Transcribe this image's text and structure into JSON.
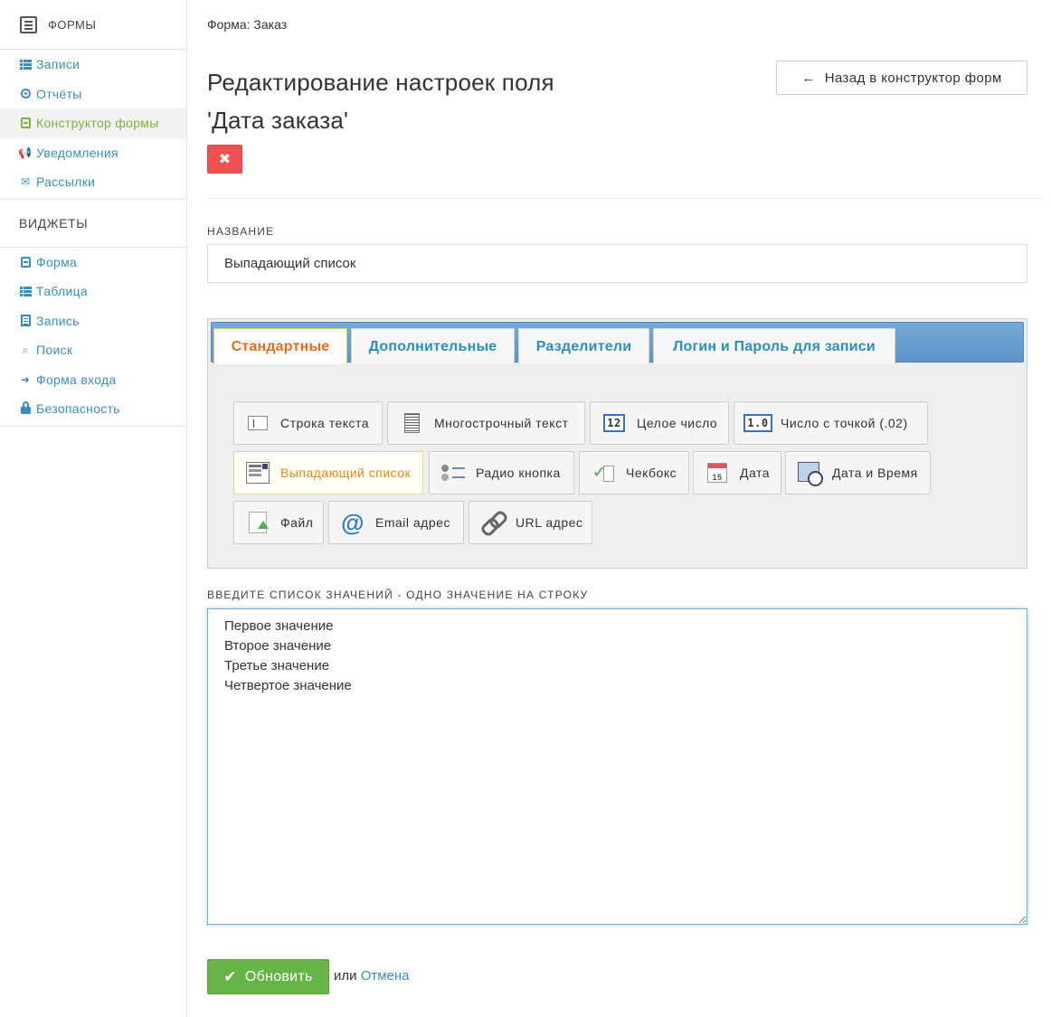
{
  "sidebar": {
    "header": "ФОРМЫ",
    "forms_items": [
      {
        "label": "Записи",
        "icon": "list-icon"
      },
      {
        "label": "Отчёты",
        "icon": "circle-dot-icon"
      },
      {
        "label": "Конструктор формы",
        "icon": "form-icon",
        "active": true
      },
      {
        "label": "Уведомления",
        "icon": "megaphone-icon"
      },
      {
        "label": "Рассылки",
        "icon": "envelope-icon"
      }
    ],
    "widgets_title": "ВИДЖЕТЫ",
    "widget_items": [
      {
        "label": "Форма",
        "icon": "form-icon"
      },
      {
        "label": "Таблица",
        "icon": "list-icon"
      },
      {
        "label": "Запись",
        "icon": "document-icon"
      },
      {
        "label": "Поиск",
        "icon": "search-icon"
      },
      {
        "label": "Форма входа",
        "icon": "sign-in-icon"
      },
      {
        "label": "Безопасность",
        "icon": "lock-icon"
      }
    ]
  },
  "main": {
    "breadcrumb": "Форма: Заказ",
    "title_line1": "Редактирование настроек поля",
    "title_line2": "'Дата заказа'",
    "delete_symbol": "✖",
    "back_button": "Назад в конструктор форм",
    "name_label": "НАЗВАНИЕ",
    "name_value": "Выпадающий список",
    "tabs": [
      {
        "label": "Стандартные",
        "active": true
      },
      {
        "label": "Дополнительные"
      },
      {
        "label": "Разделители"
      },
      {
        "label": "Логин и Пароль для записи"
      }
    ],
    "field_types": [
      {
        "label": "Строка текста",
        "icon": "text-line-icon"
      },
      {
        "label": "Многострочный текст",
        "icon": "multiline-text-icon"
      },
      {
        "label": "Целое число",
        "icon": "integer-icon",
        "glyph": "12"
      },
      {
        "label": "Число с точкой (.02)",
        "icon": "decimal-icon",
        "glyph": "1.0"
      },
      {
        "label": "Выпадающий список",
        "icon": "dropdown-icon",
        "selected": true
      },
      {
        "label": "Радио кнопка",
        "icon": "radio-icon"
      },
      {
        "label": "Чекбокс",
        "icon": "checkbox-icon"
      },
      {
        "label": "Дата",
        "icon": "calendar-icon",
        "glyph": "15"
      },
      {
        "label": "Дата и Время",
        "icon": "datetime-icon"
      },
      {
        "label": "Файл",
        "icon": "file-upload-icon"
      },
      {
        "label": "Email адрес",
        "icon": "at-icon",
        "glyph": "@"
      },
      {
        "label": "URL адрес",
        "icon": "link-icon"
      }
    ],
    "values_label": "ВВЕДИТЕ СПИСОК ЗНАЧЕНИЙ - ОДНО ЗНАЧЕНИЕ НА СТРОКУ",
    "values_text": "Первое значение\nВторое значение\nТретье значение\nЧетвертое значение",
    "update_button": "Обновить",
    "or_text": "или",
    "cancel_link": "Отмена"
  },
  "colors": {
    "link": "#3c8dbc",
    "active_green": "#7cb342",
    "danger": "#f0504f",
    "success": "#67b346",
    "tab_active": "#e0701f"
  }
}
